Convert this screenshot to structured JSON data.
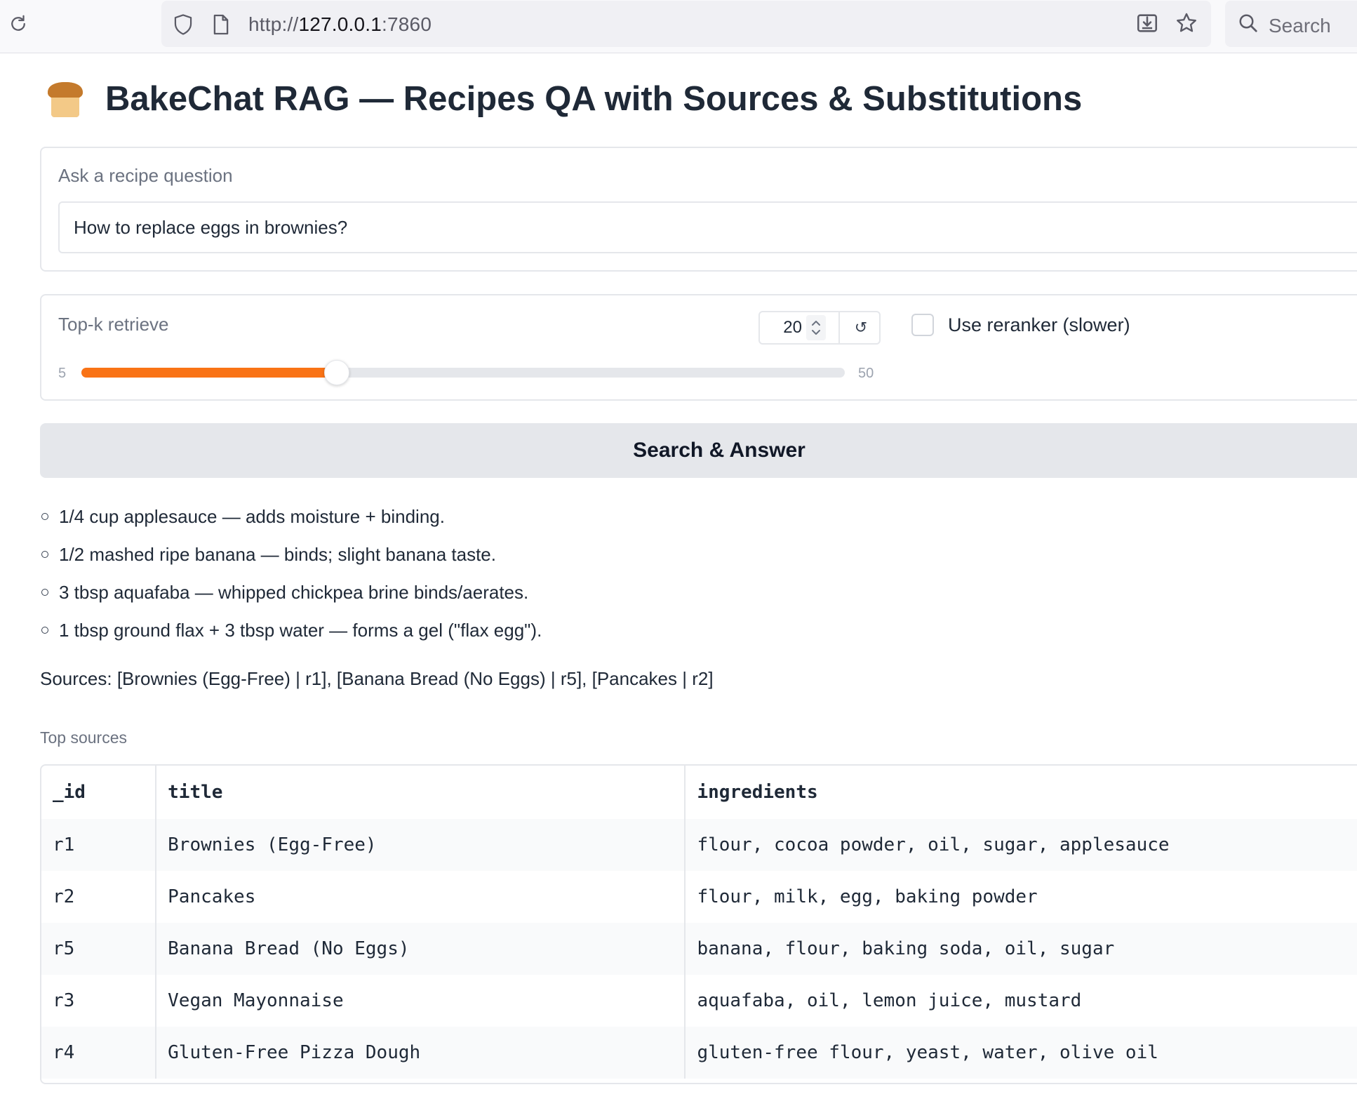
{
  "browser": {
    "url_scheme": "http://",
    "url_host": "127.0.0.1",
    "url_port": ":7860",
    "search_placeholder": "Search"
  },
  "app": {
    "title": "BakeChat RAG — Recipes QA with Sources & Substitutions",
    "title_icon": "bread-loaf-emoji"
  },
  "question": {
    "label": "Ask a recipe question",
    "value": "How to replace eggs in brownies?"
  },
  "retrieval": {
    "topk_label": "Top-k retrieve",
    "topk_value": "20",
    "topk_min": "5",
    "topk_max": "50",
    "reset_icon": "↺",
    "reranker_label": "Use reranker (slower)",
    "reranker_checked": false
  },
  "submit_label": "Search & Answer",
  "answer": {
    "items": [
      "1/4 cup applesauce — adds moisture + binding.",
      "1/2 mashed ripe banana — binds; slight banana taste.",
      "3 tbsp aquafaba — whipped chickpea brine binds/aerates.",
      "1 tbsp ground flax + 3 tbsp water — forms a gel (\"flax egg\")."
    ],
    "sources": "Sources: [Brownies (Egg-Free) | r1], [Banana Bread (No Eggs) | r5], [Pancakes | r2]"
  },
  "top_sources": {
    "label": "Top sources",
    "columns": [
      "_id",
      "title",
      "ingredients"
    ],
    "rows": [
      [
        "r1",
        "Brownies (Egg-Free)",
        "flour, cocoa powder, oil, sugar, applesauce"
      ],
      [
        "r2",
        "Pancakes",
        "flour, milk, egg, baking powder"
      ],
      [
        "r5",
        "Banana Bread (No Eggs)",
        "banana, flour, baking soda, oil, sugar"
      ],
      [
        "r3",
        "Vegan Mayonnaise",
        "aquafaba, oil, lemon juice, mustard"
      ],
      [
        "r4",
        "Gluten-Free Pizza Dough",
        "gluten-free flour, yeast, water, olive oil"
      ]
    ]
  },
  "colors": {
    "accent": "#f97316",
    "border": "#e5e7eb",
    "button_bg": "#e5e7eb"
  }
}
